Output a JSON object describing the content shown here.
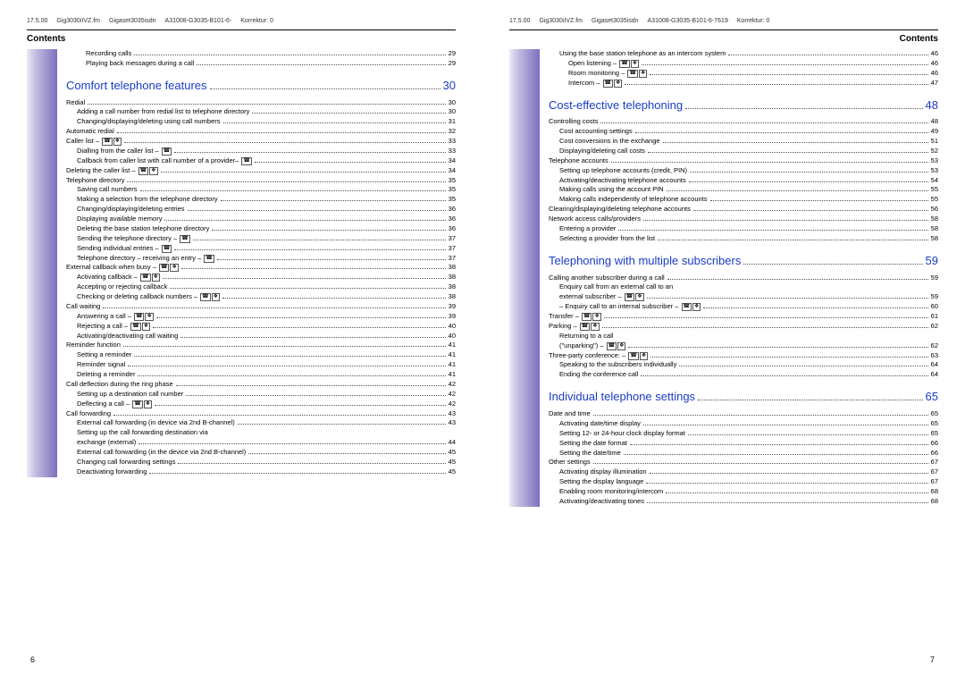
{
  "meta": {
    "left": [
      "17.5.00",
      "Gig3030iIVZ.fm",
      "Gigaset3035isdn",
      "A31008-G3035-B101-6-",
      "Korrektur: 0"
    ],
    "right": [
      "17.5.00",
      "Gig3030iIVZ.fm",
      "Gigaset3035isdn",
      "A31008-G3035-B101-6-7619",
      "Korrektur: 0"
    ]
  },
  "contents_label": "Contents",
  "page_left_num": "6",
  "page_right_num": "7",
  "left_entries": [
    {
      "lvl": 3,
      "label": "Recording calls",
      "page": "29"
    },
    {
      "lvl": 3,
      "label": "Playing back messages during a call",
      "page": "29"
    },
    {
      "section": true,
      "label": "Comfort telephone features",
      "page": "30"
    },
    {
      "lvl": 1,
      "label": "Redial",
      "page": "30"
    },
    {
      "lvl": 2,
      "label": "Adding a call number from redial list to telephone directory",
      "page": "30"
    },
    {
      "lvl": 2,
      "label": "Changing/displaying/deleting using call numbers",
      "page": "31"
    },
    {
      "lvl": 1,
      "label": "Automatic redial",
      "page": "32"
    },
    {
      "lvl": 1,
      "label": "Caller list – ",
      "icons": [
        "h",
        "c"
      ],
      "page": "33"
    },
    {
      "lvl": 2,
      "label": "Dialling from the caller list – ",
      "icons": [
        "h"
      ],
      "page": "33"
    },
    {
      "lvl": 2,
      "label": "Callback from caller list with call number of a provider– ",
      "icons": [
        "h"
      ],
      "page": "34"
    },
    {
      "lvl": 1,
      "label": "Deleting the caller list – ",
      "icons": [
        "h",
        "c"
      ],
      "page": "34"
    },
    {
      "lvl": 1,
      "label": "Telephone directory",
      "page": "35"
    },
    {
      "lvl": 2,
      "label": "Saving call numbers",
      "page": "35"
    },
    {
      "lvl": 2,
      "label": "Making a selection from the telephone directory",
      "page": "35"
    },
    {
      "lvl": 2,
      "label": "Changing/displaying/deleting entries",
      "page": "36"
    },
    {
      "lvl": 2,
      "label": "Displaying available memory",
      "page": "36"
    },
    {
      "lvl": 2,
      "label": "Deleting the base station telephone directory",
      "page": "36"
    },
    {
      "lvl": 2,
      "label": "Sending the telephone directory – ",
      "icons": [
        "h"
      ],
      "page": "37"
    },
    {
      "lvl": 2,
      "label": "Sending individual entries – ",
      "icons": [
        "h"
      ],
      "page": "37"
    },
    {
      "lvl": 2,
      "label": "Telephone directory – receiving an entry – ",
      "icons": [
        "h"
      ],
      "page": "37"
    },
    {
      "lvl": 1,
      "label": "External callback when busy – ",
      "icons": [
        "h",
        "c"
      ],
      "page": "38"
    },
    {
      "lvl": 2,
      "label": "Activating callback – ",
      "icons": [
        "h",
        "c"
      ],
      "page": "38"
    },
    {
      "lvl": 2,
      "label": "Accepting or rejecting callback",
      "page": "38"
    },
    {
      "lvl": 2,
      "label": "Checking or deleting callback numbers – ",
      "icons": [
        "h",
        "c"
      ],
      "page": "38"
    },
    {
      "lvl": 1,
      "label": "Call waiting",
      "page": "39"
    },
    {
      "lvl": 2,
      "label": "Answering a call – ",
      "icons": [
        "h",
        "c"
      ],
      "page": "39"
    },
    {
      "lvl": 2,
      "label": "Rejecting a call – ",
      "icons": [
        "h",
        "c"
      ],
      "page": "40"
    },
    {
      "lvl": 2,
      "label": "Activating/deactivating call waiting",
      "page": "40"
    },
    {
      "lvl": 1,
      "label": "Reminder function",
      "page": "41"
    },
    {
      "lvl": 2,
      "label": "Setting a reminder",
      "page": "41"
    },
    {
      "lvl": 2,
      "label": "Reminder signal",
      "page": "41"
    },
    {
      "lvl": 2,
      "label": "Deleting a reminder",
      "page": "41"
    },
    {
      "lvl": 1,
      "label": "Call deflection during the ring phase",
      "page": "42"
    },
    {
      "lvl": 2,
      "label": "Setting up a destination call number",
      "page": "42"
    },
    {
      "lvl": 2,
      "label": "Deflecting a call – ",
      "icons": [
        "h",
        "c"
      ],
      "page": "42"
    },
    {
      "lvl": 1,
      "label": "Call forwarding",
      "page": "43"
    },
    {
      "lvl": 2,
      "label": "External call forwarding (in device via 2nd B-channel)",
      "page": "43"
    },
    {
      "lvl": 2,
      "label": "Setting up the call forwarding destination via",
      "nopage": true
    },
    {
      "lvl": 2,
      "label": "exchange (external)",
      "page": "44"
    },
    {
      "lvl": 2,
      "label": "External call forwarding (in the device via 2nd B-channel)",
      "page": "45"
    },
    {
      "lvl": 2,
      "label": "Changing call forwarding settings",
      "page": "45"
    },
    {
      "lvl": 2,
      "label": "Deactivating forwarding",
      "page": "45"
    }
  ],
  "right_entries": [
    {
      "lvl": 2,
      "label": "Using the base station telephone as an intercom system",
      "page": "46"
    },
    {
      "lvl": 3,
      "label": "Open listening – ",
      "icons": [
        "h",
        "c"
      ],
      "page": "46"
    },
    {
      "lvl": 3,
      "label": "Room monitoring – ",
      "icons": [
        "h",
        "c"
      ],
      "page": "46"
    },
    {
      "lvl": 3,
      "label": "Intercom – ",
      "icons": [
        "h",
        "c"
      ],
      "page": "47"
    },
    {
      "section": true,
      "label": "Cost-effective telephoning",
      "page": "48"
    },
    {
      "lvl": 1,
      "label": "Controlling costs",
      "page": "48"
    },
    {
      "lvl": 2,
      "label": "Cost accounting settings",
      "page": "49"
    },
    {
      "lvl": 2,
      "label": "Cost conversions in the exchange",
      "page": "51"
    },
    {
      "lvl": 2,
      "label": "Displaying/deleting call costs",
      "page": "52"
    },
    {
      "lvl": 1,
      "label": "Telephone accounts",
      "page": "53"
    },
    {
      "lvl": 2,
      "label": "Setting up telephone accounts (credit, PIN)",
      "page": "53"
    },
    {
      "lvl": 2,
      "label": "Activating/deactivating telephone accounts",
      "page": "54"
    },
    {
      "lvl": 2,
      "label": "Making calls using the account PIN",
      "page": "55"
    },
    {
      "lvl": 2,
      "label": "Making calls independently of telephone accounts",
      "page": "55"
    },
    {
      "lvl": 1,
      "label": "Clearing/displaying/deleting telephone accounts",
      "page": "56"
    },
    {
      "lvl": 1,
      "label": "Network access calls/providers",
      "page": "58"
    },
    {
      "lvl": 2,
      "label": "Entering a provider",
      "page": "58"
    },
    {
      "lvl": 2,
      "label": "Selecting a provider from the list",
      "page": "58"
    },
    {
      "section": true,
      "label": "Telephoning with multiple subscribers",
      "page": "59"
    },
    {
      "lvl": 1,
      "label": "Calling another subscriber during a call",
      "page": "59"
    },
    {
      "lvl": 2,
      "label": "Enquiry call from an external call to an",
      "nopage": true
    },
    {
      "lvl": 2,
      "label": "external subscriber – ",
      "icons": [
        "h",
        "c"
      ],
      "page": "59"
    },
    {
      "lvl": 2,
      "label": "– Enquiry call to an internal subscriber – ",
      "icons": [
        "h",
        "c"
      ],
      "page": "60"
    },
    {
      "lvl": 1,
      "label": "Transfer – ",
      "icons": [
        "h",
        "c"
      ],
      "page": "61"
    },
    {
      "lvl": 1,
      "label": "Parking – ",
      "icons": [
        "h",
        "c"
      ],
      "page": "62"
    },
    {
      "lvl": 2,
      "label": "Returning to a call",
      "nopage": true
    },
    {
      "lvl": 2,
      "label": "(\"unparking\") – ",
      "icons": [
        "h",
        "c"
      ],
      "page": "62"
    },
    {
      "lvl": 1,
      "label": "Three-party conference: – ",
      "icons": [
        "h",
        "c"
      ],
      "page": "63"
    },
    {
      "lvl": 2,
      "label": "Speaking to the subscribers individually",
      "page": "64"
    },
    {
      "lvl": 2,
      "label": "Ending the conference call",
      "page": "64"
    },
    {
      "section": true,
      "label": "Individual telephone settings",
      "page": "65"
    },
    {
      "lvl": 1,
      "label": "Date and time",
      "page": "65"
    },
    {
      "lvl": 2,
      "label": "Activating date/time display",
      "page": "65"
    },
    {
      "lvl": 2,
      "label": "Setting 12- or 24-hour clock display format",
      "page": "65"
    },
    {
      "lvl": 2,
      "label": "Setting the date format",
      "page": "66"
    },
    {
      "lvl": 2,
      "label": "Setting the date/time",
      "page": "66"
    },
    {
      "lvl": 1,
      "label": "Other settings",
      "page": "67"
    },
    {
      "lvl": 2,
      "label": "Activating display illumination",
      "page": "67"
    },
    {
      "lvl": 2,
      "label": "Setting the display language",
      "page": "67"
    },
    {
      "lvl": 2,
      "label": "Enabling room monitoring/intercom",
      "page": "68"
    },
    {
      "lvl": 2,
      "label": "Activating/deactivating tones",
      "page": "68"
    }
  ]
}
